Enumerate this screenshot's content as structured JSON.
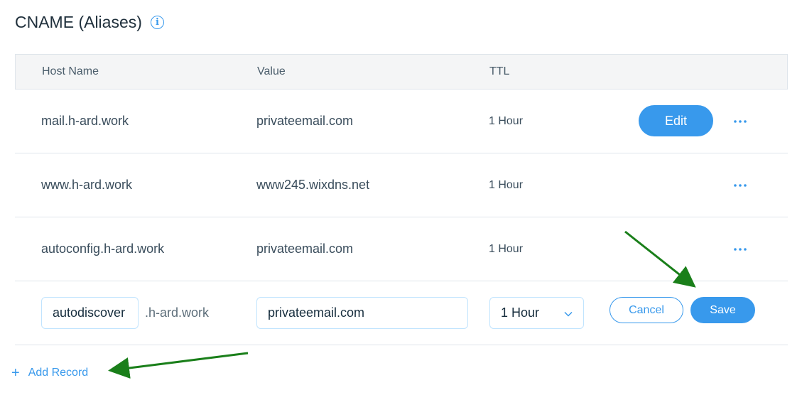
{
  "section": {
    "title": "CNAME (Aliases)",
    "info_icon": "info-icon"
  },
  "table": {
    "headers": {
      "host": "Host Name",
      "value": "Value",
      "ttl": "TTL"
    },
    "rows": [
      {
        "host": "mail.h-ard.work",
        "value": "privateemail.com",
        "ttl": "1 Hour",
        "edit_label": "Edit"
      },
      {
        "host": "www.h-ard.work",
        "value": "www245.wixdns.net",
        "ttl": "1 Hour"
      },
      {
        "host": "autoconfig.h-ard.work",
        "value": "privateemail.com",
        "ttl": "1 Hour"
      }
    ],
    "more_icon": "more-dots-icon"
  },
  "new_record": {
    "host_value": "autodiscover",
    "host_suffix": ".h-ard.work",
    "value_value": "privateemail.com",
    "ttl_selected": "1 Hour",
    "cancel_label": "Cancel",
    "save_label": "Save"
  },
  "add_record_label": "Add Record",
  "annotation_color": "#1a7f1a",
  "accent_color": "#3899ec"
}
